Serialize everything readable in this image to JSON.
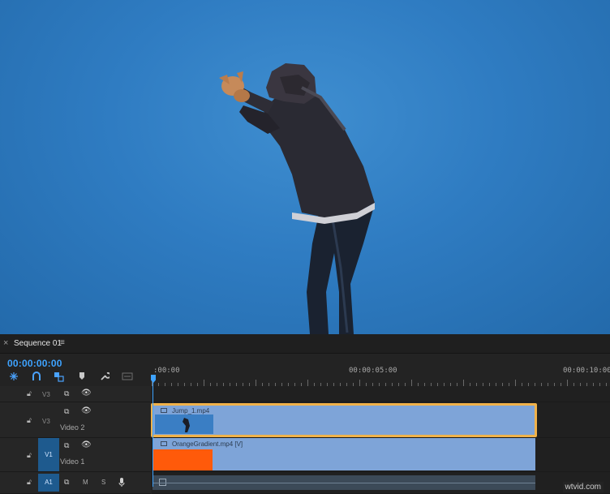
{
  "sequence_tab": {
    "close_glyph": "×",
    "title": "Sequence 01",
    "menu_glyph": "≡"
  },
  "timecode": "00:00:00:00",
  "tools": [
    "insert-icon",
    "snap-icon",
    "linked-selection-icon",
    "marker-icon",
    "wrench-icon",
    "captions-icon"
  ],
  "ruler": {
    "labels": [
      ":00:00",
      "00:00:05:00",
      "00:00:10:00"
    ]
  },
  "tracks": {
    "v3": {
      "name": "V3"
    },
    "v2": {
      "name": "V3",
      "label": "Video 2"
    },
    "v1": {
      "source": "V1",
      "label": "Video 1"
    },
    "a1": {
      "source": "A1",
      "m": "M",
      "s": "S"
    }
  },
  "clips": {
    "jump": {
      "name": "Jump_1.mp4"
    },
    "gradient": {
      "name": "OrangeGradient.mp4 [V]"
    }
  },
  "colors": {
    "timecode": "#3ea3ff",
    "clip": "#7ea4d8",
    "selection": "#f0b24a",
    "orange_thumb": "#ff5a0a",
    "source_patch": "#1e5a8e"
  },
  "watermark": "wtvid.com"
}
